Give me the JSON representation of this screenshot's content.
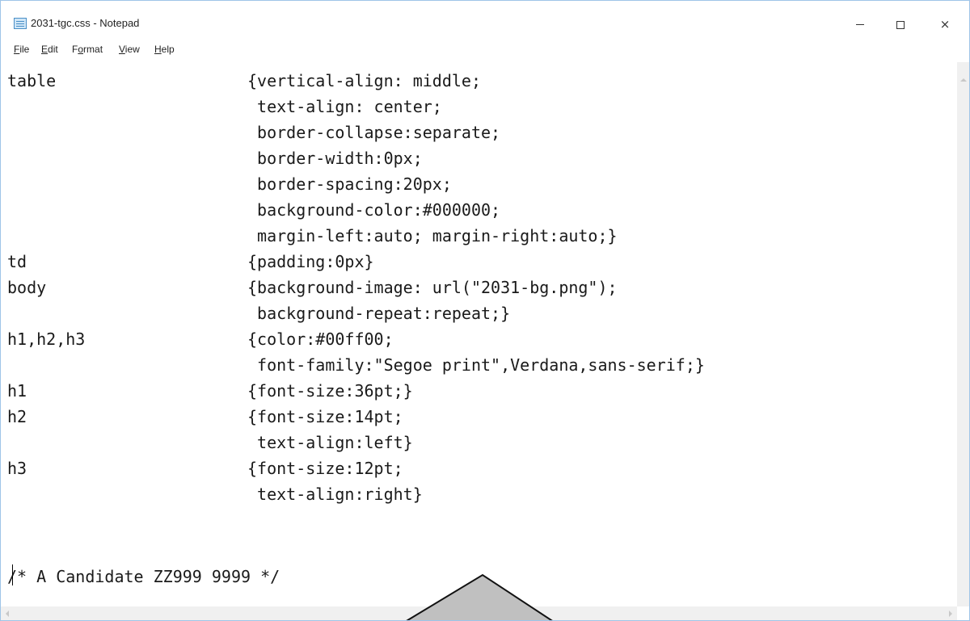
{
  "window": {
    "title": "2031-tgc.css - Notepad",
    "controls": {
      "minimize": "minimize",
      "maximize": "maximize",
      "close": "×"
    }
  },
  "menu": {
    "items": [
      {
        "label": "File",
        "accel": "F",
        "rest": "ile"
      },
      {
        "label": "Edit",
        "accel": "E",
        "rest": "dit"
      },
      {
        "label": "Format",
        "accel": "o",
        "rest": ""
      },
      {
        "label": "View",
        "accel": "V",
        "rest": "iew"
      },
      {
        "label": "Help",
        "accel": "H",
        "rest": "elp"
      }
    ]
  },
  "editor": {
    "lines": [
      {
        "selector": "table",
        "decl": "{vertical-align: middle;"
      },
      {
        "selector": "",
        "decl": " text-align: center;"
      },
      {
        "selector": "",
        "decl": " border-collapse:separate;"
      },
      {
        "selector": "",
        "decl": " border-width:0px;"
      },
      {
        "selector": "",
        "decl": " border-spacing:20px;"
      },
      {
        "selector": "",
        "decl": " background-color:#000000;"
      },
      {
        "selector": "",
        "decl": " margin-left:auto; margin-right:auto;}"
      },
      {
        "selector": "td",
        "decl": "{padding:0px}"
      },
      {
        "selector": "body",
        "decl": "{background-image: url(\"2031-bg.png\");"
      },
      {
        "selector": "",
        "decl": " background-repeat:repeat;}"
      },
      {
        "selector": "h1,h2,h3",
        "decl": "{color:#00ff00;"
      },
      {
        "selector": "",
        "decl": " font-family:\"Segoe print\",Verdana,sans-serif;}"
      },
      {
        "selector": "h1",
        "decl": "{font-size:36pt;}"
      },
      {
        "selector": "h2",
        "decl": "{font-size:14pt;"
      },
      {
        "selector": "",
        "decl": " text-align:left}"
      },
      {
        "selector": "h3",
        "decl": "{font-size:12pt;"
      },
      {
        "selector": "",
        "decl": " text-align:right}"
      },
      {
        "selector": "/* A Candidate ZZ999 9999 */",
        "decl": ""
      }
    ]
  },
  "colors": {
    "window_border": "#9fc5e8",
    "text": "#1a1a1a",
    "scrollbar": "#f0f0f0",
    "pointer_fill": "#c0c0c0"
  }
}
